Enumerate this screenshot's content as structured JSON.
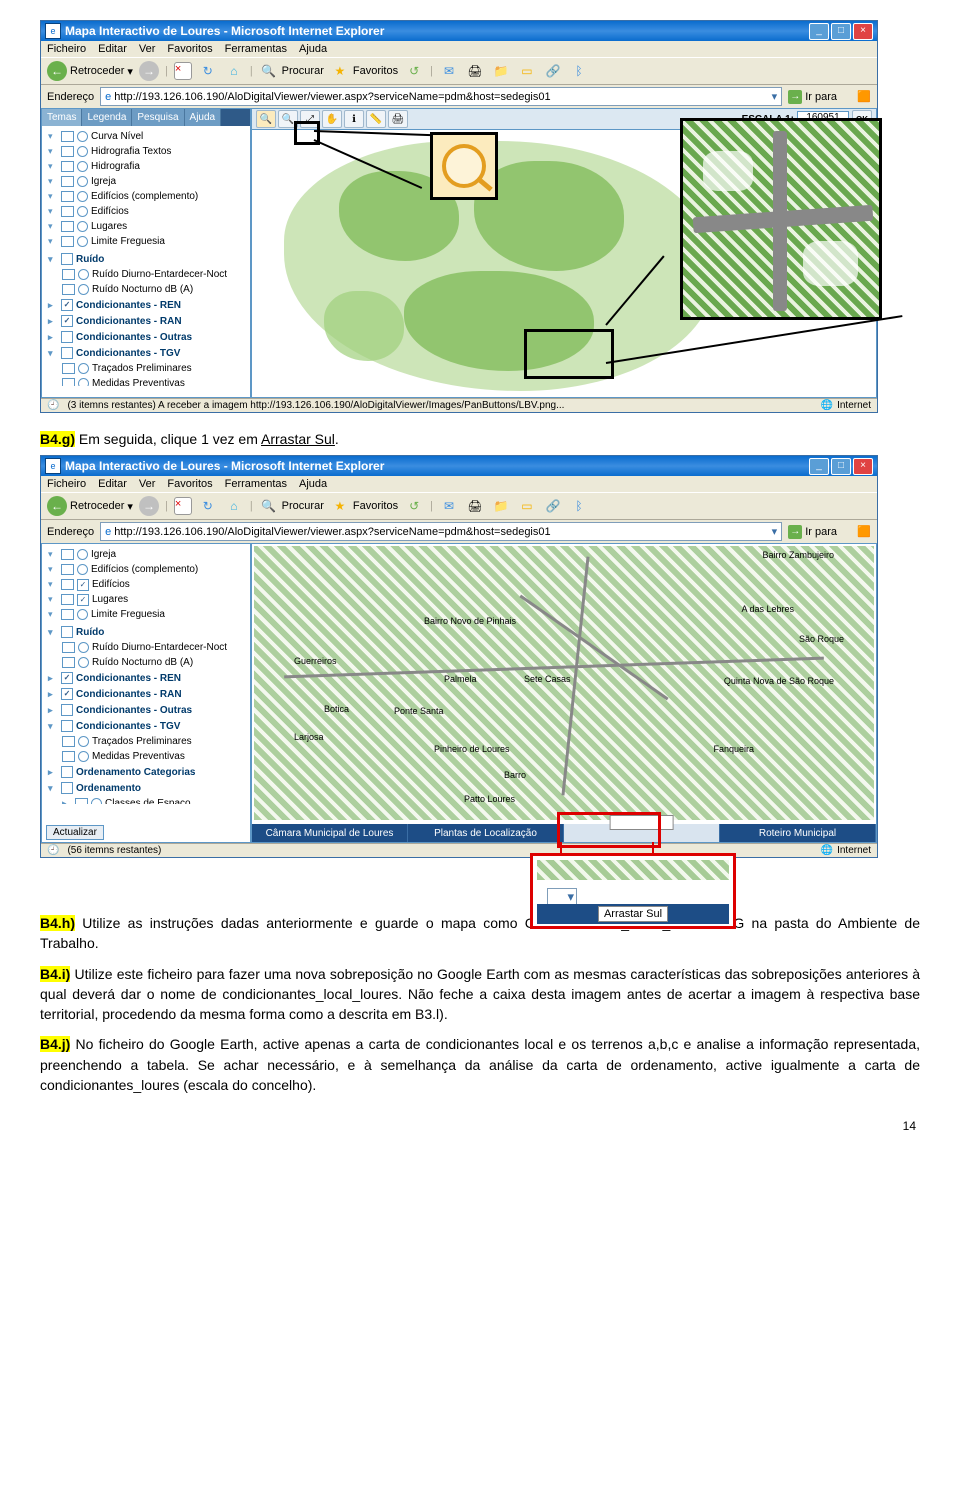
{
  "ie1": {
    "title": "Mapa Interactivo de Loures - Microsoft Internet Explorer",
    "menu": [
      "Ficheiro",
      "Editar",
      "Ver",
      "Favoritos",
      "Ferramentas",
      "Ajuda"
    ],
    "retroceder": "Retroceder",
    "procurar": "Procurar",
    "favoritos": "Favoritos",
    "endereco_lbl": "Endereço",
    "endereco_val": "http://193.126.106.190/AloDigitalViewer/viewer.aspx?serviceName=pdm&host=sedegis01",
    "irpara": "Ir para",
    "tabs": [
      "Temas",
      "Legenda",
      "Pesquisa",
      "Ajuda"
    ],
    "layers_top": [
      "Curva Nível",
      "Hidrografia Textos",
      "Hidrografia",
      "Igreja",
      "Edifícios (complemento)",
      "Edifícios",
      "Lugares",
      "Limite Freguesia"
    ],
    "groups": [
      {
        "title": "Ruído",
        "items": [
          "Ruído Diurno-Entardecer-Noct",
          "Ruído Nocturno dB (A)"
        ]
      },
      {
        "title": "Condicionantes - REN",
        "checked": true,
        "items": []
      },
      {
        "title": "Condicionantes - RAN",
        "checked": true,
        "items": []
      },
      {
        "title": "Condicionantes - Outras",
        "items": []
      },
      {
        "title": "Condicionantes - TGV",
        "items": [
          "Traçados Preliminares",
          "Medidas Preventivas"
        ]
      },
      {
        "title": "Ordenamento Categorias",
        "items": []
      },
      {
        "title": "Ordenamento",
        "items": []
      }
    ],
    "classes": "Classes de Espaço",
    "escala_lbl": "ESCALA 1:",
    "escala_val": "160951",
    "ok": "OK",
    "status_left": "(3 itemns restantes) A receber a imagem http://193.126.106.190/AloDigitalViewer/Images/PanButtons/LBV.png...",
    "status_right": "Internet"
  },
  "step_g": {
    "tag": "B4.g)",
    "text": " Em seguida, clique 1 vez em ",
    "link": "Arrastar Sul",
    "tail": "."
  },
  "ie2": {
    "title": "Mapa Interactivo de Loures - Microsoft Internet Explorer",
    "layers_top": [
      "Igreja",
      "Edifícios (complemento)",
      "Edifícios",
      "Lugares",
      "Limite Freguesia"
    ],
    "actualizar": "Actualizar",
    "bottom_nav": [
      "Câmara Municipal de Loures",
      "Plantas de Localização",
      "",
      "Roteiro Municipal"
    ],
    "arrastar_label": "Arrastar Sul",
    "place_labels": [
      "Bairro Zambujeiro",
      "A das Lebres",
      "Bairro Novo de Pinhais",
      "São Roque",
      "Guerreiros",
      "Palmela",
      "Sete Casas",
      "Quinta Nova de São Roque",
      "Botica",
      "Ponte Santa",
      "Larjosa",
      "Pinheiro de Loures",
      "Fanqueira",
      "Barro",
      "Patto Loures"
    ],
    "status_left": "(56 itemns restantes)",
    "status_right": "Internet",
    "arrastar_big": "Arrastar Sul"
  },
  "step_h": {
    "tag": "B4.h)",
    "text1": " Utilize as instruções dadas anteriormente e guarde o mapa como Condicionantes_Local_Loures.JPG na pasta do Ambiente de Trabalho."
  },
  "step_i": {
    "tag": "B4.i)",
    "text": " Utilize este ficheiro para fazer uma nova sobreposição no Google Earth com as mesmas características das sobreposições anteriores à qual deverá dar o nome de condicionantes_local_loures. Não feche a caixa desta imagem antes de acertar a imagem à respectiva base territorial, procedendo da mesma forma como a descrita em B3.l)."
  },
  "step_j": {
    "tag": "B4.j)",
    "text": " No ficheiro do Google Earth, active apenas a carta de condicionantes local e os terrenos a,b,c e analise a informação representada, preenchendo a tabela. Se achar necessário, e à semelhança da análise da carta de ordenamento, active igualmente a carta de condicionantes_loures (escala do concelho)."
  },
  "page_num": "14"
}
